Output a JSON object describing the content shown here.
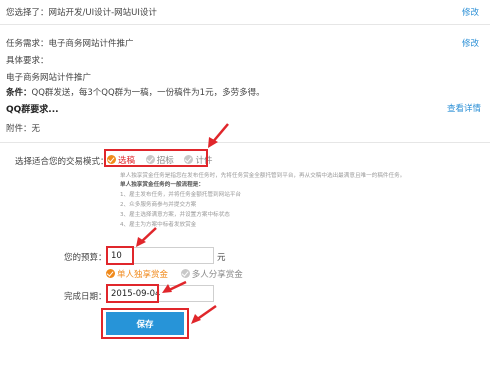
{
  "selection": {
    "label": "您选择了：网站开发/UI设计-网站UI设计",
    "edit": "修改"
  },
  "task": {
    "requirement_label": "任务需求：电子商务网站计件推广",
    "edit": "修改",
    "detail_label": "具体要求：",
    "detail_text": "电子商务网站计件推广",
    "condition_label": "条件：",
    "condition_text": "QQ群发送，每3个QQ群为一稿，一份稿件为1元，多劳多得。",
    "qq_requirement": "QQ群要求...",
    "view_detail": "查看详情",
    "attachment": "附件：无"
  },
  "mode": {
    "label": "选择适合您的交易模式：",
    "options": [
      "选稿",
      "招标",
      "计件"
    ],
    "selected": "选稿"
  },
  "description": {
    "line1": "单人独享赏金任务是指您在发布任务时，先将任务赏金全额托管到平台，再从交稿中选出最满意且唯一的稿件任务。",
    "title": "单人独享赏金任务的一般流程是：",
    "steps": [
      "1、雇主发布任务，并将任务金额托管到网站平台",
      "2、众多服务商参与并提交方案",
      "3、雇主选择满意方案，并设置方案中标状态",
      "4、雇主为方案中标者发放赏金"
    ]
  },
  "budget": {
    "label": "您的预算：",
    "value": "10",
    "unit": "元"
  },
  "reward": {
    "options": [
      "单人独享赏金",
      "多人分享赏金"
    ],
    "selected": "单人独享赏金"
  },
  "date": {
    "label": "完成日期：",
    "value": "2015-09-04"
  },
  "save_label": "保存",
  "colors": {
    "accent": "#2794d8",
    "link": "#2a8fd6",
    "highlight": "#e0262b",
    "selected_radio": "#f08a1c"
  }
}
